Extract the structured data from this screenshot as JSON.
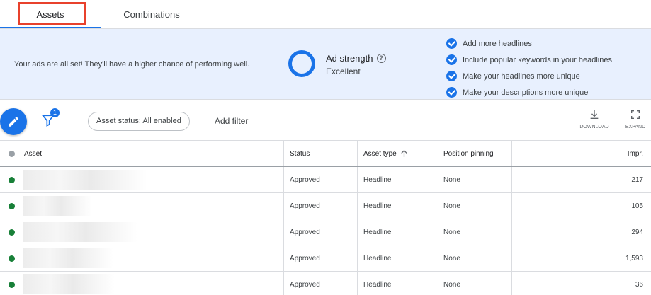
{
  "tabs": [
    {
      "label": "Assets",
      "active": true
    },
    {
      "label": "Combinations",
      "active": false
    }
  ],
  "banner": {
    "message": "Your ads are all set! They'll have a higher chance of performing well.",
    "strength_label": "Ad strength",
    "strength_value": "Excellent",
    "checklist": [
      "Add more headlines",
      "Include popular keywords in your headlines",
      "Make your headlines more unique",
      "Make your descriptions more unique"
    ]
  },
  "toolbar": {
    "filter_count": "1",
    "status_chip": "Asset status: All enabled",
    "add_filter": "Add filter",
    "download_label": "DOWNLOAD",
    "expand_label": "EXPAND"
  },
  "table": {
    "headers": {
      "asset": "Asset",
      "status": "Status",
      "asset_type": "Asset type",
      "position_pinning": "Position pinning",
      "impr": "Impr."
    },
    "rows": [
      {
        "status": "Approved",
        "asset_type": "Headline",
        "pinning": "None",
        "impr": "217"
      },
      {
        "status": "Approved",
        "asset_type": "Headline",
        "pinning": "None",
        "impr": "105"
      },
      {
        "status": "Approved",
        "asset_type": "Headline",
        "pinning": "None",
        "impr": "294"
      },
      {
        "status": "Approved",
        "asset_type": "Headline",
        "pinning": "None",
        "impr": "1,593"
      },
      {
        "status": "Approved",
        "asset_type": "Headline",
        "pinning": "None",
        "impr": "36"
      }
    ]
  },
  "colors": {
    "accent": "#1a73e8",
    "banner_bg": "#e8f0fe",
    "status_green": "#188038",
    "tab_highlight": "#e8412c"
  }
}
